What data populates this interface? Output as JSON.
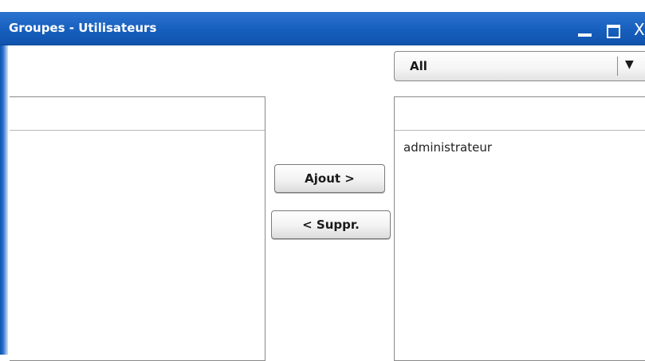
{
  "window": {
    "title": "Groupes - Utilisateurs",
    "titlebar_color": "#175fbd",
    "controls": {
      "minimize_icon": "minimize-icon",
      "maximize_icon": "maximize-icon",
      "close_icon": "close-icon",
      "close_glyph": "X"
    }
  },
  "filter": {
    "selected": "All",
    "arrow": "▼"
  },
  "actions": {
    "add_label": "Ajout >",
    "remove_label": "< Suppr."
  },
  "left_list": {
    "items": []
  },
  "right_list": {
    "items": [
      "administrateur"
    ]
  }
}
